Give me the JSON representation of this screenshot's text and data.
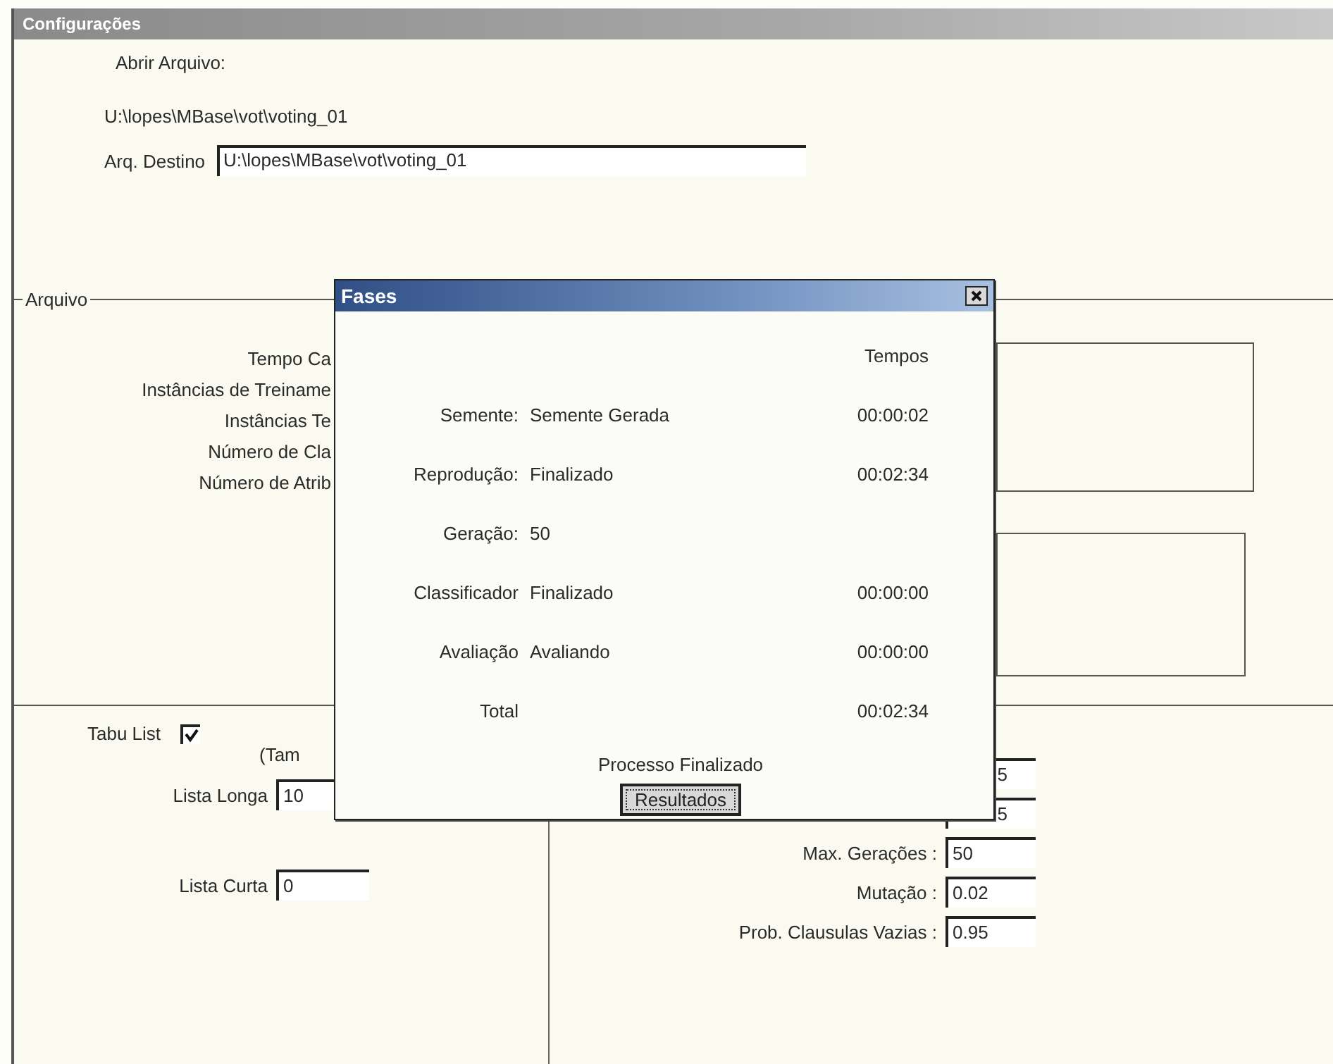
{
  "window": {
    "title": "Configurações"
  },
  "open_file": {
    "label": "Abrir Arquivo:",
    "path": "U:\\lopes\\MBase\\vot\\voting_01"
  },
  "destination": {
    "label": "Arq. Destino",
    "value": "U:\\lopes\\MBase\\vot\\voting_01"
  },
  "file_group": {
    "title": "Arquivo",
    "labels": [
      "Tempo Ca",
      "Instâncias de Treiname",
      "Instâncias Te",
      "Número de Cla",
      "Número de Atrib"
    ]
  },
  "tabu": {
    "label": "Tabu List",
    "checked": true,
    "note": "(Tam",
    "fields": [
      {
        "label": "Lista Longa",
        "value": "10"
      },
      {
        "label": "Lista Curta",
        "value": "0"
      }
    ]
  },
  "parameters": [
    {
      "value": "5"
    },
    {
      "value": "5"
    },
    {
      "label": "Max. Gerações :",
      "value": "50"
    },
    {
      "label": "Mutação :",
      "value": "0.02"
    },
    {
      "label": "Prob. Clausulas Vazias :",
      "value": "0.95"
    }
  ],
  "dialog": {
    "title": "Fases",
    "time_header": "Tempos",
    "rows": [
      {
        "label": "Semente:",
        "status": "Semente Gerada",
        "time": "00:00:02"
      },
      {
        "label": "Reprodução:",
        "status": "Finalizado",
        "time": "00:02:34"
      },
      {
        "label": "Geração:",
        "status": "50"
      },
      {
        "label": "Classificador",
        "status": "Finalizado",
        "time": "00:00:00"
      },
      {
        "label": "Avaliação",
        "status": "Avaliando",
        "time": "00:00:00"
      },
      {
        "label": "Total",
        "time": "00:02:34"
      }
    ],
    "message": "Processo Finalizado",
    "button": "Resultados"
  }
}
